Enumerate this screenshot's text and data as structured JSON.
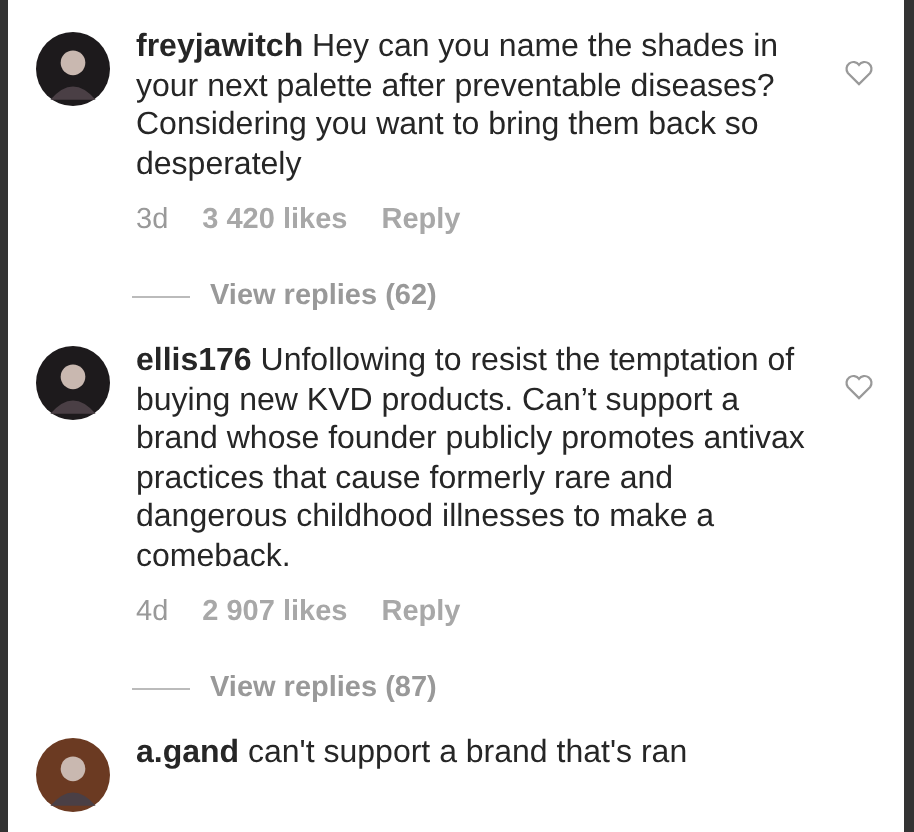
{
  "comments": [
    {
      "username": "freyjawitch",
      "text": "Hey can you name the shades in your next palette after preventable diseases? Considering you want to bring them back so desperately",
      "time": "3d",
      "likes": "3 420 likes",
      "reply": "Reply",
      "view_replies": "View replies (62)",
      "liked": false
    },
    {
      "username": "ellis176",
      "text": "Unfollowing to resist the temptation of buying new KVD products. Can’t support a brand whose founder publicly promotes antivax practices that cause formerly rare and dangerous childhood illnesses to make a comeback.",
      "time": "4d",
      "likes": "2 907 likes",
      "reply": "Reply",
      "view_replies": "View replies (87)",
      "liked": false
    },
    {
      "username": "a.gand",
      "text": "can't support a brand that's ran"
    }
  ]
}
